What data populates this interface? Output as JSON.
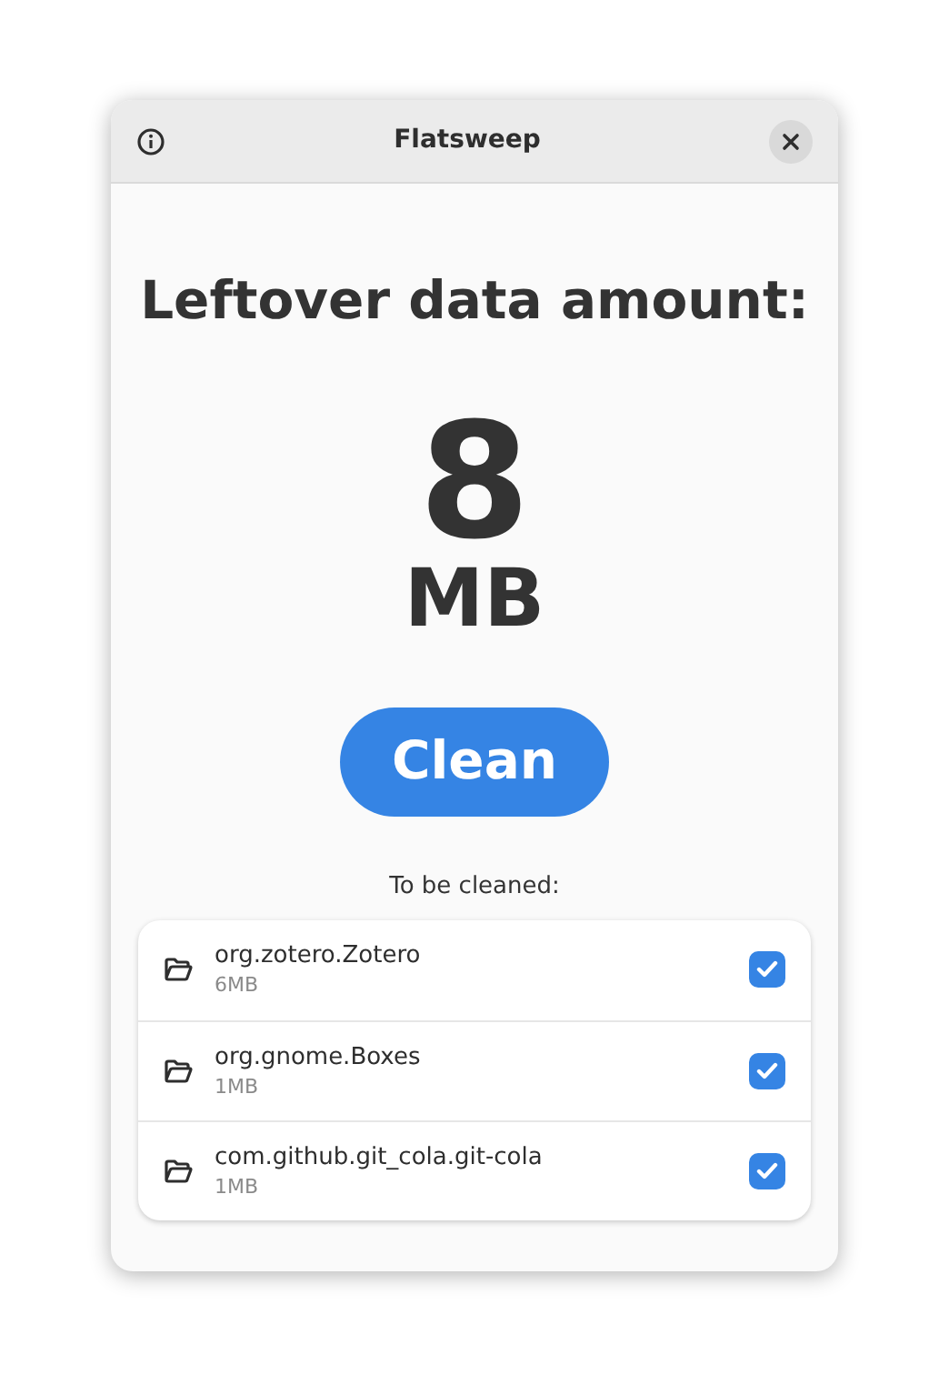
{
  "window": {
    "title": "Flatsweep"
  },
  "heading": "Leftover data amount:",
  "amount": {
    "value": "8",
    "unit": "MB"
  },
  "clean_button": "Clean",
  "list_label": "To be cleaned:",
  "items": [
    {
      "name": "org.zotero.Zotero",
      "size": "6MB",
      "checked": true
    },
    {
      "name": "org.gnome.Boxes",
      "size": "1MB",
      "checked": true
    },
    {
      "name": "com.github.git_cola.git-cola",
      "size": "1MB",
      "checked": true
    }
  ]
}
